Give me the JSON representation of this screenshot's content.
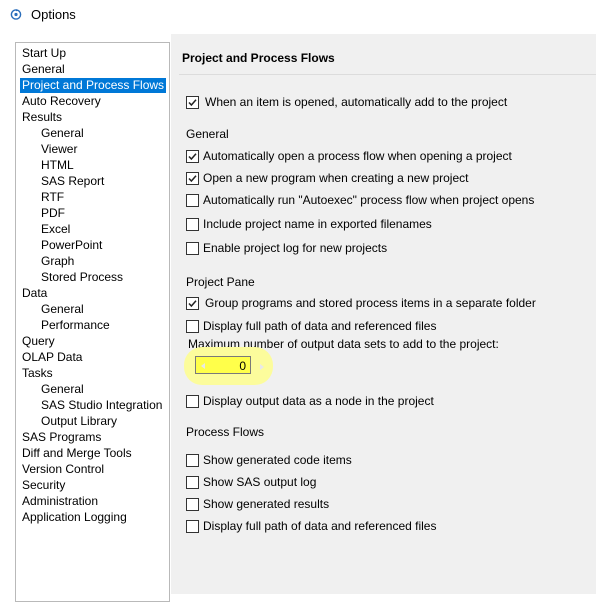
{
  "window": {
    "title": "Options",
    "app_icon": "sas-eg-icon"
  },
  "tree": {
    "items": [
      {
        "label": "Start Up",
        "level": 0,
        "selected": false
      },
      {
        "label": "General",
        "level": 0,
        "selected": false
      },
      {
        "label": "Project and Process Flows",
        "level": 0,
        "selected": true
      },
      {
        "label": "Auto Recovery",
        "level": 0,
        "selected": false
      },
      {
        "label": "Results",
        "level": 0,
        "selected": false
      },
      {
        "label": "General",
        "level": 1,
        "selected": false
      },
      {
        "label": "Viewer",
        "level": 1,
        "selected": false
      },
      {
        "label": "HTML",
        "level": 1,
        "selected": false
      },
      {
        "label": "SAS Report",
        "level": 1,
        "selected": false
      },
      {
        "label": "RTF",
        "level": 1,
        "selected": false
      },
      {
        "label": "PDF",
        "level": 1,
        "selected": false
      },
      {
        "label": "Excel",
        "level": 1,
        "selected": false
      },
      {
        "label": "PowerPoint",
        "level": 1,
        "selected": false
      },
      {
        "label": "Graph",
        "level": 1,
        "selected": false
      },
      {
        "label": "Stored Process",
        "level": 1,
        "selected": false
      },
      {
        "label": "Data",
        "level": 0,
        "selected": false
      },
      {
        "label": "General",
        "level": 1,
        "selected": false
      },
      {
        "label": "Performance",
        "level": 1,
        "selected": false
      },
      {
        "label": "Query",
        "level": 0,
        "selected": false
      },
      {
        "label": "OLAP Data",
        "level": 0,
        "selected": false
      },
      {
        "label": "Tasks",
        "level": 0,
        "selected": false
      },
      {
        "label": "General",
        "level": 1,
        "selected": false
      },
      {
        "label": "SAS Studio Integration",
        "level": 1,
        "selected": false
      },
      {
        "label": "Output Library",
        "level": 1,
        "selected": false
      },
      {
        "label": "SAS Programs",
        "level": 0,
        "selected": false
      },
      {
        "label": "Diff and Merge Tools",
        "level": 0,
        "selected": false
      },
      {
        "label": "Version Control",
        "level": 0,
        "selected": false
      },
      {
        "label": "Security",
        "level": 0,
        "selected": false
      },
      {
        "label": "Administration",
        "level": 0,
        "selected": false
      },
      {
        "label": "Application Logging",
        "level": 0,
        "selected": false
      }
    ]
  },
  "panel": {
    "title": "Project and Process Flows",
    "auto_add": {
      "label": "When an item is opened, automatically add to the project",
      "checked": true
    },
    "general": {
      "label": "General",
      "options": [
        {
          "label": "Automatically open a process flow when opening a project",
          "checked": true
        },
        {
          "label": "Open a new program when creating a new project",
          "checked": true
        },
        {
          "label": "Automatically run \"Autoexec\" process flow when project opens",
          "checked": false
        },
        {
          "label": "Include project name in exported filenames",
          "checked": false
        },
        {
          "label": "Enable project log for new projects",
          "checked": false
        }
      ]
    },
    "project_pane": {
      "label": "Project Pane",
      "options": [
        {
          "label": "Group programs and stored process items in a separate folder",
          "checked": true
        },
        {
          "label": "Display full path of data and referenced files",
          "checked": false
        }
      ],
      "max_output_label": "Maximum number of output data sets to add to the project:",
      "max_output_value": "0",
      "display_output": {
        "label": "Display output data as a node in the project",
        "checked": false
      }
    },
    "process_flows": {
      "label": "Process Flows",
      "options": [
        {
          "label": "Show generated code items",
          "checked": false
        },
        {
          "label": "Show SAS output log",
          "checked": false
        },
        {
          "label": "Show generated results",
          "checked": false
        },
        {
          "label": "Display full path of data and referenced files",
          "checked": false
        }
      ]
    }
  },
  "colors": {
    "selection": "#0078d7",
    "panel_bg": "#f0f0f0",
    "highlight": "#fcfc9c",
    "spinner_bg": "#ffff4a"
  }
}
